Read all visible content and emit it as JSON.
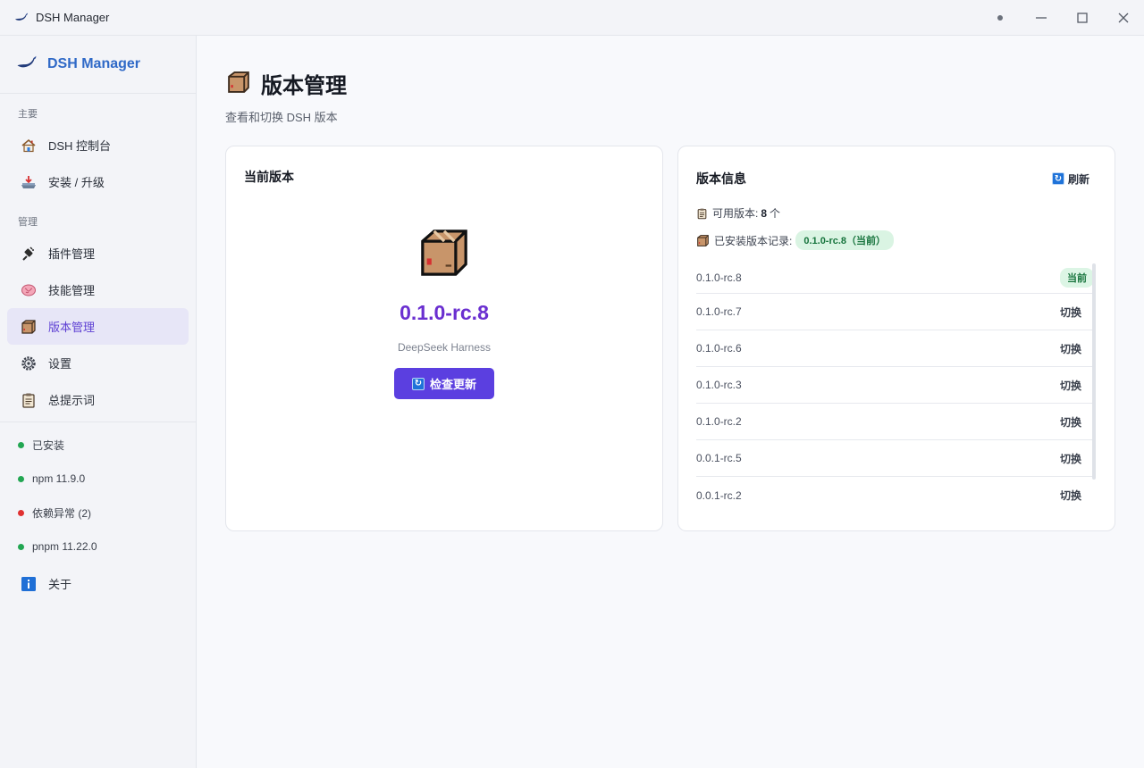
{
  "window": {
    "title": "DSH Manager",
    "controls": [
      "dot",
      "minimize",
      "maximize",
      "close"
    ]
  },
  "sidebar": {
    "brand": "DSH Manager",
    "groups": [
      {
        "label": "主要",
        "items": [
          {
            "label": "DSH 控制台",
            "icon": "house-icon"
          },
          {
            "label": "安装 / 升级",
            "icon": "install-tray-icon"
          }
        ]
      },
      {
        "label": "管理",
        "items": [
          {
            "label": "插件管理",
            "icon": "plug-icon"
          },
          {
            "label": "技能管理",
            "icon": "brain-icon"
          },
          {
            "label": "版本管理",
            "icon": "package-icon",
            "active": true
          },
          {
            "label": "设置",
            "icon": "gear-icon"
          },
          {
            "label": "总提示词",
            "icon": "clipboard-icon"
          }
        ]
      }
    ],
    "status": [
      {
        "label": "已安装",
        "color": "#22a652"
      },
      {
        "label": "npm 11.9.0",
        "color": "#22a652"
      },
      {
        "label": "依赖异常 (2)",
        "color": "#e03131"
      },
      {
        "label": "pnpm 11.22.0",
        "color": "#22a652"
      }
    ],
    "about": {
      "label": "关于",
      "icon": "info-icon"
    }
  },
  "page": {
    "title": "版本管理",
    "subtitle": "查看和切换 DSH 版本"
  },
  "current": {
    "card_title": "当前版本",
    "version": "0.1.0-rc.8",
    "description": "DeepSeek Harness",
    "check_button": "检查更新"
  },
  "info": {
    "card_title": "版本信息",
    "refresh_label": "刷新",
    "available_label": "可用版本:",
    "available_count": "8",
    "available_unit": "个",
    "installed_label": "已安装版本记录:",
    "installed_tag": "0.1.0-rc.8（当前）",
    "versions": [
      {
        "version": "0.1.0-rc.8",
        "action": "当前",
        "current": true
      },
      {
        "version": "0.1.0-rc.7",
        "action": "切换"
      },
      {
        "version": "0.1.0-rc.6",
        "action": "切换"
      },
      {
        "version": "0.1.0-rc.3",
        "action": "切换"
      },
      {
        "version": "0.1.0-rc.2",
        "action": "切换"
      },
      {
        "version": "0.0.1-rc.5",
        "action": "切换"
      },
      {
        "version": "0.0.1-rc.2",
        "action": "切换"
      }
    ]
  },
  "colors": {
    "accent": "#5b3fe0",
    "version_text": "#6a2fd0",
    "brand_text": "#2f69c7",
    "success": "#22a652",
    "error": "#e03131"
  }
}
